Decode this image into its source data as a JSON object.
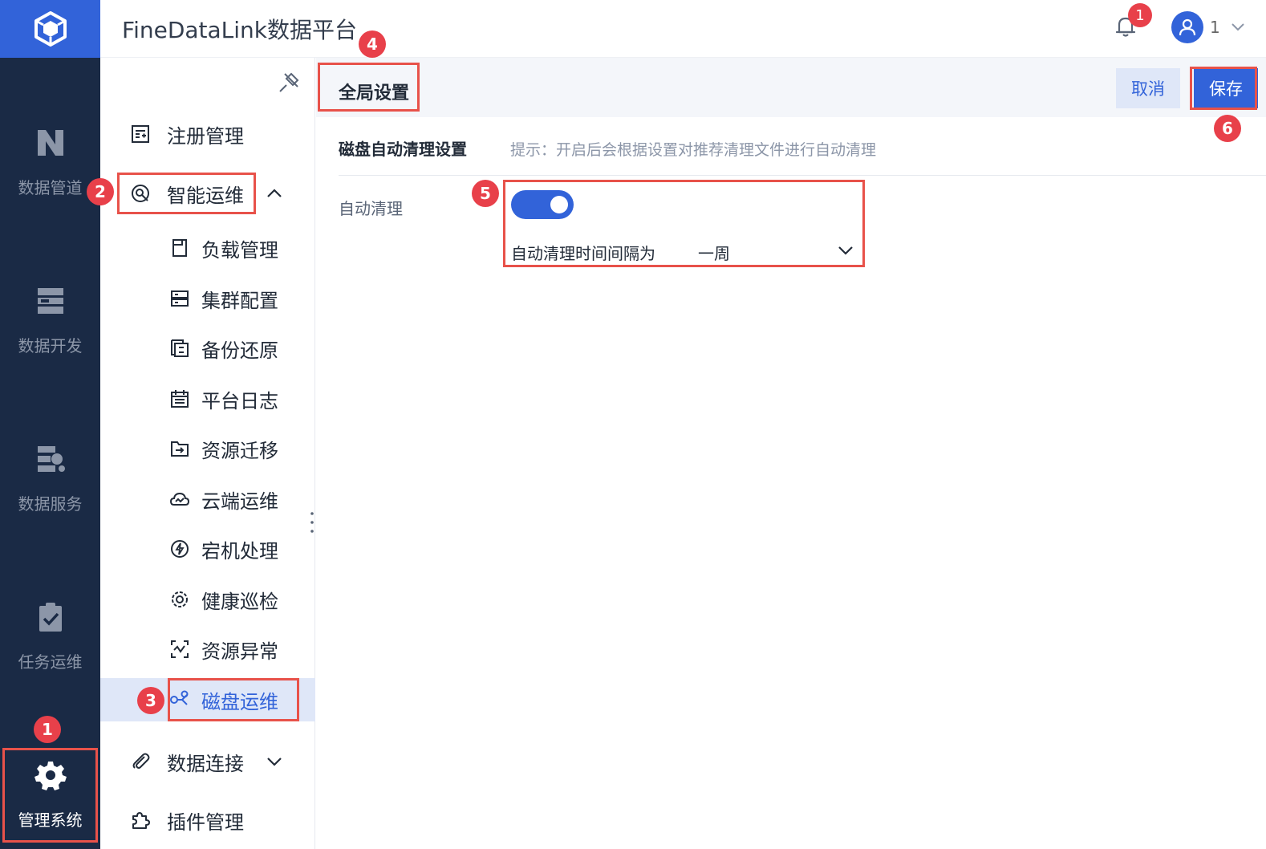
{
  "app": {
    "title": "FineDataLink数据平台",
    "logo_icon": "cube-logo-icon",
    "notification_count": "1",
    "user_name": "1"
  },
  "rail": [
    {
      "label": "数据管道",
      "icon": "data-pipeline-icon"
    },
    {
      "label": "数据开发",
      "icon": "data-dev-icon"
    },
    {
      "label": "数据服务",
      "icon": "data-service-icon"
    },
    {
      "label": "任务运维",
      "icon": "task-ops-icon"
    },
    {
      "label": "管理系统",
      "icon": "gear-icon"
    }
  ],
  "menu": {
    "items": [
      {
        "label": "注册管理",
        "icon": "register-icon"
      },
      {
        "label": "智能运维",
        "icon": "smart-ops-icon"
      },
      {
        "label": "负载管理",
        "icon": "load-icon"
      },
      {
        "label": "集群配置",
        "icon": "cluster-icon"
      },
      {
        "label": "备份还原",
        "icon": "backup-icon"
      },
      {
        "label": "平台日志",
        "icon": "calendar-log-icon"
      },
      {
        "label": "资源迁移",
        "icon": "migrate-icon"
      },
      {
        "label": "云端运维",
        "icon": "cloud-ops-icon"
      },
      {
        "label": "宕机处理",
        "icon": "lightning-icon"
      },
      {
        "label": "健康巡检",
        "icon": "health-gear-icon"
      },
      {
        "label": "资源异常",
        "icon": "resource-anomaly-icon"
      },
      {
        "label": "磁盘运维",
        "icon": "disk-ops-icon"
      },
      {
        "label": "数据连接",
        "icon": "paperclip-icon"
      },
      {
        "label": "插件管理",
        "icon": "puzzle-icon"
      }
    ]
  },
  "content": {
    "tab_title": "全局设置",
    "cancel_label": "取消",
    "save_label": "保存",
    "section_title": "磁盘自动清理设置",
    "section_hint": "提示：开启后会根据设置对推荐清理文件进行自动清理",
    "auto_clean_label": "自动清理",
    "auto_clean_enabled": true,
    "interval_label": "自动清理时间间隔为",
    "interval_value": "一周"
  },
  "annotations": [
    "1",
    "2",
    "3",
    "4",
    "5",
    "6"
  ],
  "colors": {
    "primary": "#3263d9",
    "rail_bg": "#1a2a45",
    "annotation": "#e8404a",
    "selected_bg": "#dfe7f8"
  }
}
